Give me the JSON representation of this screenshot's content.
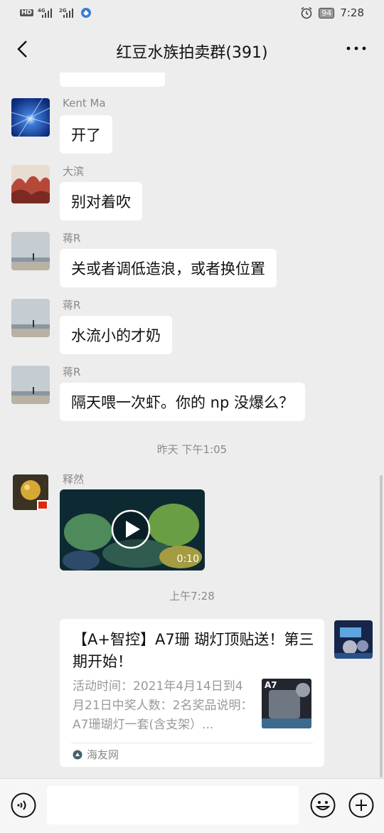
{
  "status_bar": {
    "left_indicators": "HD 4G 2G",
    "battery": "94",
    "time": "7:28"
  },
  "header": {
    "title": "红豆水族拍卖群(391)"
  },
  "messages": [
    {
      "sender": "Kent Ma",
      "text": "开了"
    },
    {
      "sender": "大滨",
      "text": "别对着吹"
    },
    {
      "sender": "蒋R",
      "text": "关或者调低造浪，或者换位置"
    },
    {
      "sender": "蒋R",
      "text": "水流小的才奶"
    },
    {
      "sender": "蒋R",
      "text": "隔天喂一次虾。你的 np 没爆么？"
    }
  ],
  "timestamps": [
    "昨天 下午1:05",
    "上午7:28"
  ],
  "video_message": {
    "sender": "释然",
    "duration": "0:10"
  },
  "link_card": {
    "title": "【A+智控】A7珊 瑚灯顶贴送！第三期开始！",
    "description": "活动时间：2021年4月14日到4月21日中奖人数：2名奖品说明：A7珊瑚灯一套(含支架）...",
    "thumb_label": "A7",
    "source": "海友网"
  },
  "colors": {
    "background": "#ededed",
    "bubble": "#ffffff",
    "meta_text": "#8a8a8a"
  }
}
